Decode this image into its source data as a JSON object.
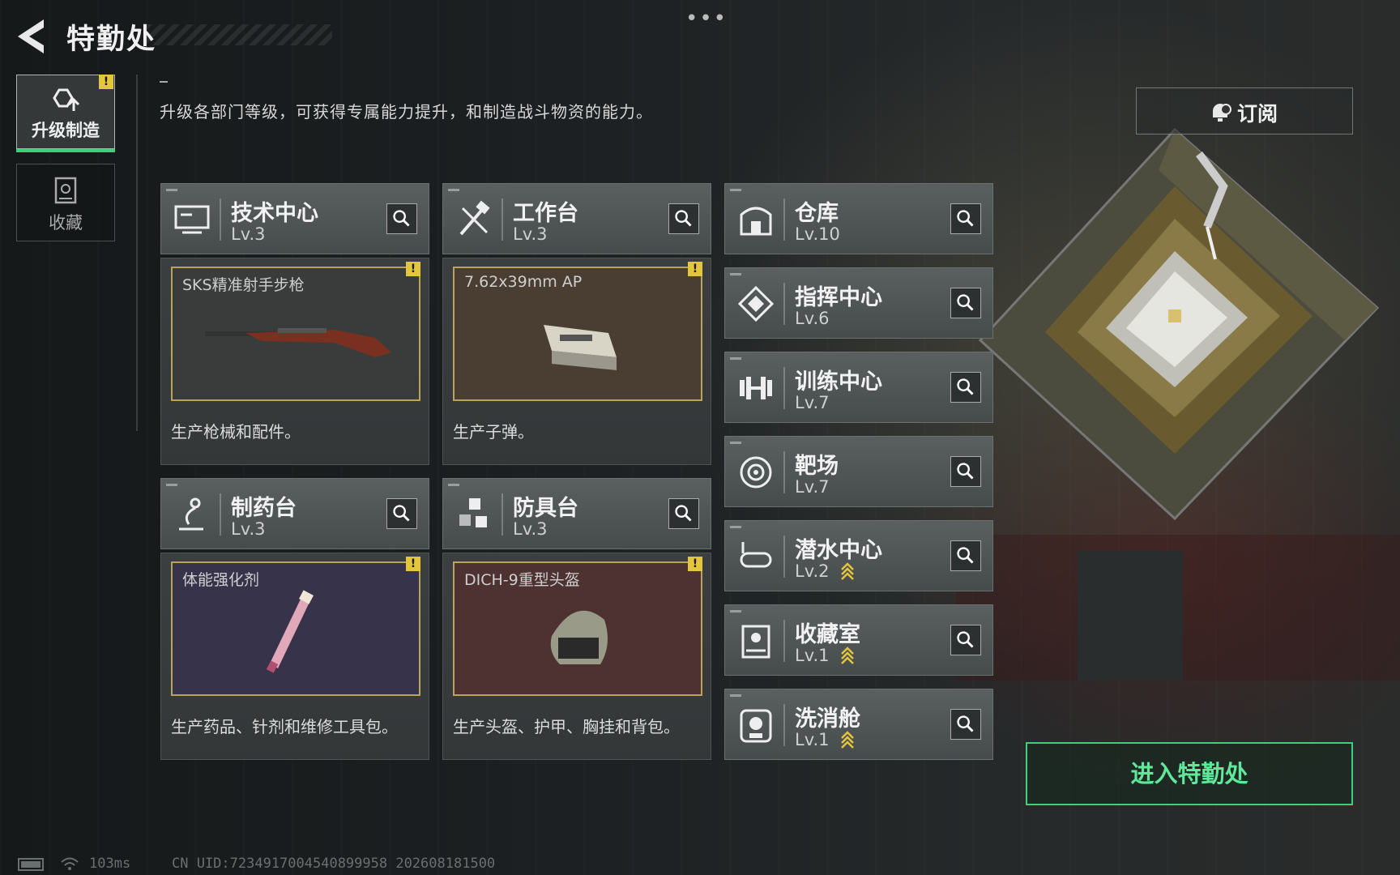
{
  "header": {
    "title": "特勤处",
    "more": "•••"
  },
  "sidebar": {
    "tabs": [
      {
        "label": "升级制造",
        "icon": "upgrade-icon",
        "active": true,
        "badge": "!"
      },
      {
        "label": "收藏",
        "icon": "collection-icon",
        "active": false
      }
    ]
  },
  "main": {
    "description": "升级各部门等级，可获得专属能力提升，和制造战斗物资的能力。",
    "subscribe_label": "订阅",
    "production_departments": [
      {
        "name": "技术中心",
        "level": "Lv.3",
        "icon": "monitor-icon",
        "item_name": "SKS精准射手步枪",
        "item_icon": "rifle-icon",
        "badge": "!",
        "description": "生产枪械和配件。",
        "panel_color": "#3a3c3c"
      },
      {
        "name": "工作台",
        "level": "Lv.3",
        "icon": "tools-icon",
        "item_name": "7.62x39mm AP",
        "item_icon": "ammo-box-icon",
        "badge": "!",
        "description": "生产子弹。",
        "panel_color": "#4a3e32"
      },
      {
        "name": "制药台",
        "level": "Lv.3",
        "icon": "microscope-icon",
        "item_name": "体能强化剂",
        "item_icon": "injector-icon",
        "badge": "!",
        "description": "生产药品、针剂和维修工具包。",
        "panel_color": "#37334a"
      },
      {
        "name": "防具台",
        "level": "Lv.3",
        "icon": "blocks-icon",
        "item_name": "DICH-9重型头盔",
        "item_icon": "helmet-icon",
        "badge": "!",
        "description": "生产头盔、护甲、胸挂和背包。",
        "panel_color": "#4e3131"
      }
    ],
    "other_departments": [
      {
        "name": "仓库",
        "level": "Lv.10",
        "icon": "warehouse-icon",
        "upgradable": false
      },
      {
        "name": "指挥中心",
        "level": "Lv.6",
        "icon": "chip-icon",
        "upgradable": false
      },
      {
        "name": "训练中心",
        "level": "Lv.7",
        "icon": "dumbbell-icon",
        "upgradable": false
      },
      {
        "name": "靶场",
        "level": "Lv.7",
        "icon": "target-icon",
        "upgradable": false
      },
      {
        "name": "潜水中心",
        "level": "Lv.2",
        "icon": "diving-mask-icon",
        "upgradable": true
      },
      {
        "name": "收藏室",
        "level": "Lv.1",
        "icon": "collection-room-icon",
        "upgradable": true
      },
      {
        "name": "洗消舱",
        "level": "Lv.1",
        "icon": "decon-icon",
        "upgradable": true
      }
    ],
    "upgrade_mark": "^",
    "enter_button": "进入特勤处"
  },
  "footer": {
    "ping": "103ms",
    "uid": "CN UID:7234917004540899958 202608181500"
  },
  "colors": {
    "accent_green": "#3fcf7a",
    "badge_yellow": "#e4c63c",
    "item_border": "#b8a45a"
  }
}
